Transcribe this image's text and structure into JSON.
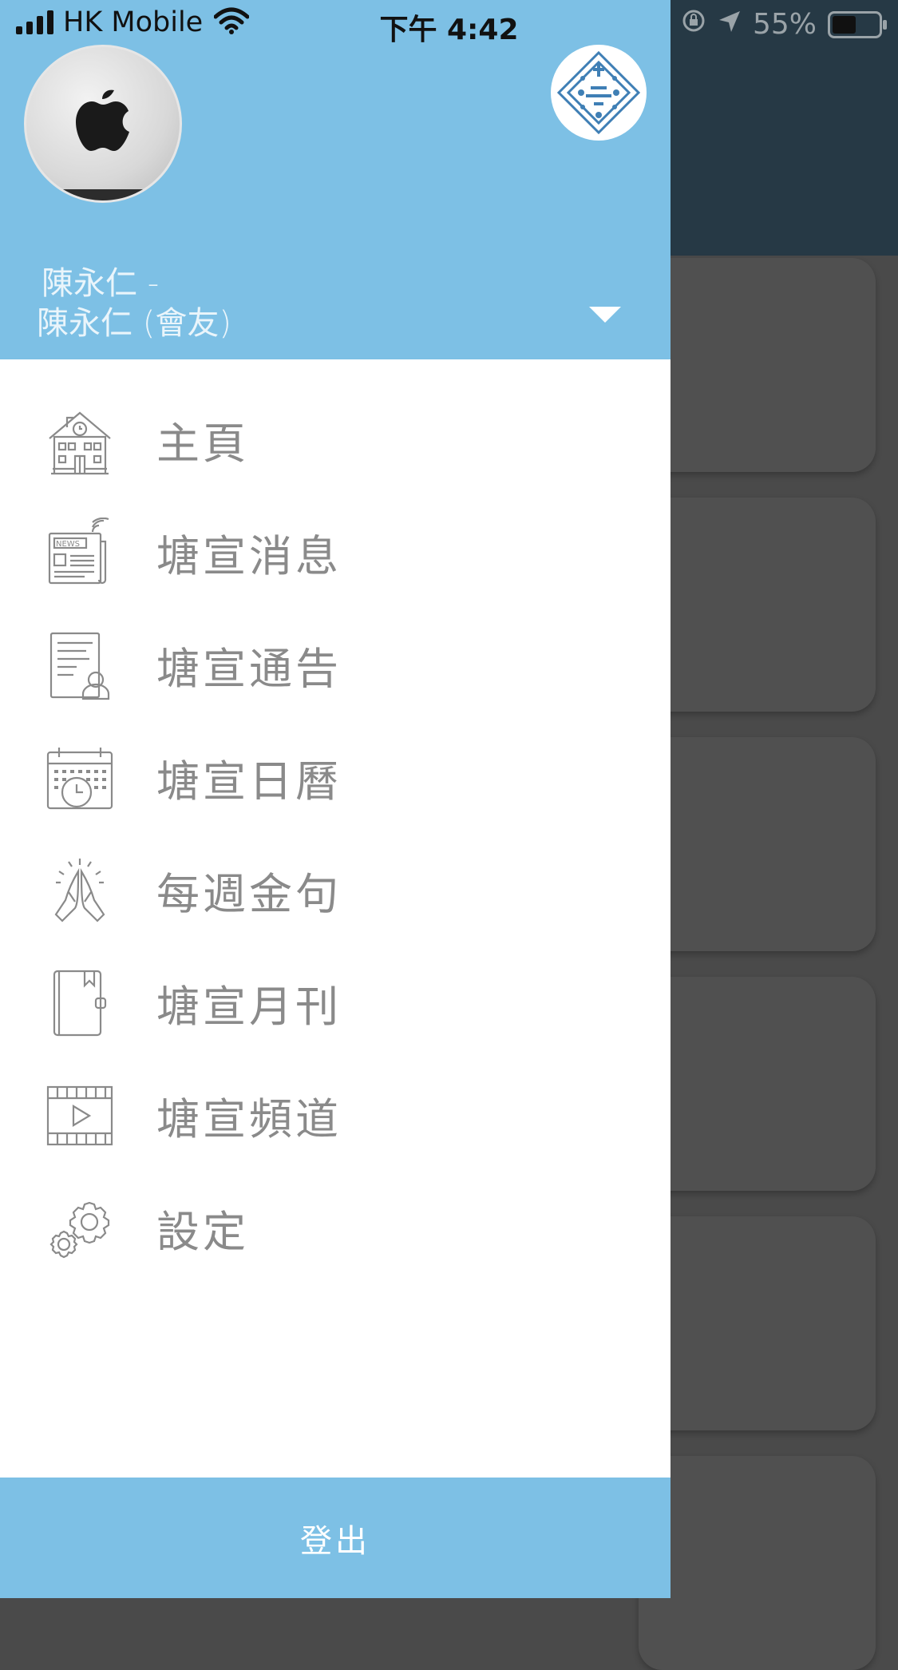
{
  "status_bar": {
    "carrier": "HK Mobile",
    "time": "下午 4:42",
    "battery": "55%",
    "battery_level": 0.55
  },
  "drawer": {
    "user_line1": "陳永仁 -",
    "user_line2": "陳永仁 (會友)",
    "menu": [
      {
        "label": "主頁",
        "icon": "school-building-icon"
      },
      {
        "label": "塘宣消息",
        "icon": "newspaper-icon"
      },
      {
        "label": "塘宣通告",
        "icon": "notice-document-icon"
      },
      {
        "label": "塘宣日曆",
        "icon": "calendar-clock-icon"
      },
      {
        "label": "每週金句",
        "icon": "praying-hands-icon"
      },
      {
        "label": "塘宣月刊",
        "icon": "book-icon"
      },
      {
        "label": "塘宣頻道",
        "icon": "video-film-icon"
      },
      {
        "label": "設定",
        "icon": "gears-icon"
      }
    ],
    "logout_label": "登出"
  },
  "colors": {
    "accent": "#7dc0e5",
    "menu_text": "#8a8a8a",
    "overlay": "#4a4a4a"
  }
}
